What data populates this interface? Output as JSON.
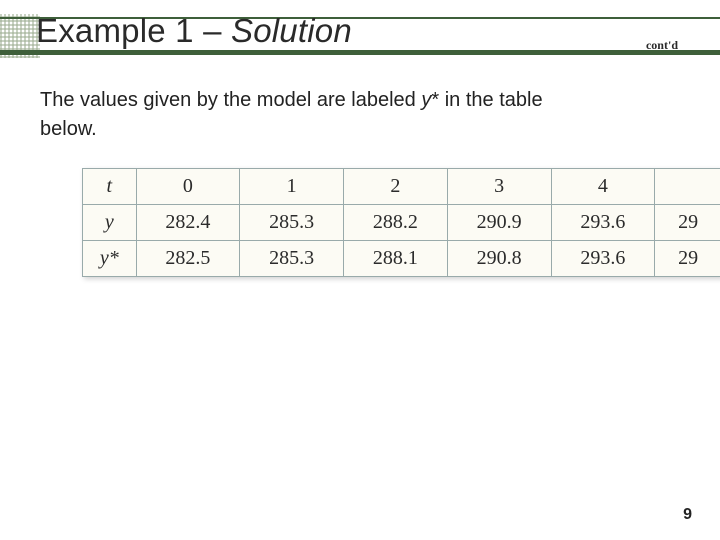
{
  "header": {
    "title_plain": "Example 1 – ",
    "title_italic": "Solution",
    "contd": "cont'd"
  },
  "body": {
    "line1_a": "The values given by the model  are labeled ",
    "line1_y": "y",
    "line1_star": "*",
    "line1_b": " in the table",
    "line2": "below."
  },
  "chart_data": {
    "type": "table",
    "title": "",
    "row_labels": [
      "t",
      "y",
      "y*"
    ],
    "columns_visible": [
      "0",
      "1",
      "2",
      "3",
      "4",
      ""
    ],
    "rows": {
      "t": [
        "0",
        "1",
        "2",
        "3",
        "4",
        ""
      ],
      "y": [
        "282.4",
        "285.3",
        "288.2",
        "290.9",
        "293.6",
        "29"
      ],
      "ystar": [
        "282.5",
        "285.3",
        "288.1",
        "290.8",
        "293.6",
        "29"
      ]
    }
  },
  "page_number": "9"
}
